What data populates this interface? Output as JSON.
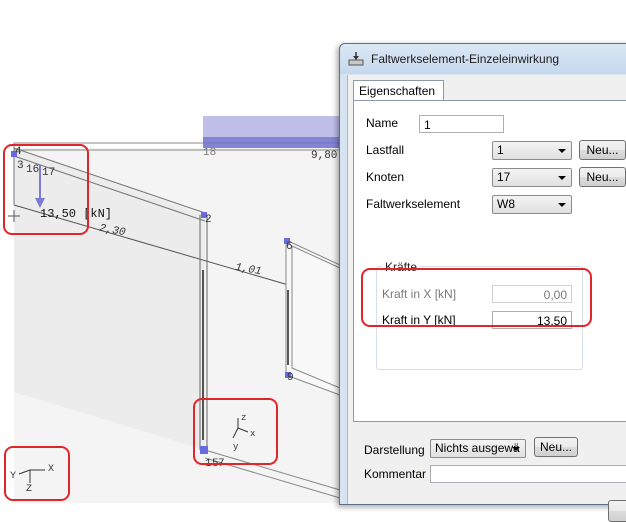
{
  "viewport": {
    "node_labels": [
      "4",
      "3",
      "16",
      "17",
      "18",
      "2",
      "6",
      "9",
      "1",
      "5",
      "7",
      "8"
    ],
    "member_labels": [
      "2,30",
      "1,01",
      "9,80"
    ],
    "load_value_label": "13,50 [kN]",
    "local_axis_labels": {
      "x": "x",
      "y": "y",
      "z": "z"
    },
    "global_axis_labels": {
      "x": "X",
      "y": "Y",
      "z": "Z"
    },
    "colors": {
      "load": "#7b7bd6",
      "node": "#6a6adf",
      "highlight": "#e0262b"
    }
  },
  "dialog": {
    "title": "Faltwerkselement-Einzeleinwirkung",
    "title_icon": "load-icon",
    "tab_label": "Eigenschaften",
    "name_label": "Name",
    "name_value": "1",
    "lastfall_label": "Lastfall",
    "lastfall_value": "1",
    "knoten_label": "Knoten",
    "knoten_value": "17",
    "faltwerkselement_label": "Faltwerkselement",
    "faltwerkselement_value": "W8",
    "new_button_label": "Neu...",
    "kraefte_label": "Kräfte",
    "kraft_x_label": "Kraft in X [kN]",
    "kraft_x_value": "0,00",
    "kraft_y_label": "Kraft in Y [kN]",
    "kraft_y_value": "13,50",
    "darstellung_label": "Darstellung",
    "darstellung_value": "Nichts ausgewä",
    "kommentar_label": "Kommentar",
    "kommentar_value": ""
  }
}
